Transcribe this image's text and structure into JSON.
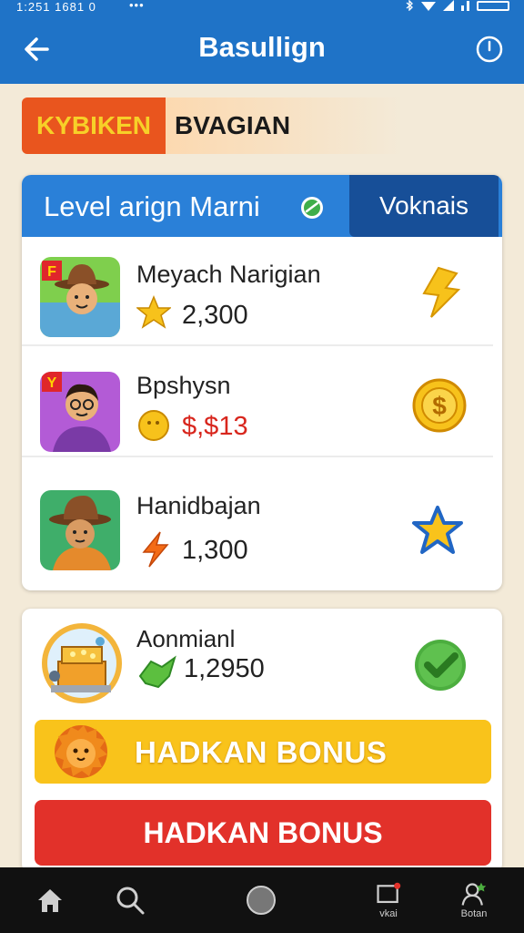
{
  "status_bar": {
    "time": "1:251 1681 0",
    "dots": "•••"
  },
  "app_bar": {
    "title": "Basullign"
  },
  "banner": {
    "left_text": "KYBIKEN",
    "right_text": "BVAGIAN"
  },
  "leaderboard": {
    "header": "Level arign  Marni",
    "tab_label": "Voknais",
    "rows": [
      {
        "name": "Meyach Narigian",
        "score": "2,300",
        "score_color": "#222222",
        "score_icon": "star-icon",
        "reward_icon": "lightning-icon"
      },
      {
        "name": "Bpshysn",
        "score": "$,$13",
        "score_color": "#d8261d",
        "score_icon": "coin-icon",
        "reward_icon": "dollar-coin-icon"
      },
      {
        "name": "Hanidbajan",
        "score": "1,300",
        "score_color": "#222222",
        "score_icon": "lightning-icon",
        "reward_icon": "star-icon"
      }
    ]
  },
  "bonus_panel": {
    "name": "Aonmianl",
    "score": "1,2950",
    "bonus_primary": "HADKAN BONUS",
    "bonus_secondary": "HADKAN BONUS"
  },
  "bottom_nav": {
    "items": [
      {
        "label": "",
        "icon": "home-icon"
      },
      {
        "label": "",
        "icon": "search-icon"
      },
      {
        "label": "",
        "icon": "circle-icon"
      },
      {
        "label": "vkai",
        "icon": "inbox-icon"
      },
      {
        "label": "Botan",
        "icon": "profile-icon"
      }
    ]
  },
  "colors": {
    "accent": "#1f73c7",
    "header_blue": "#2a80d8",
    "dark_tab": "#174f98",
    "yellow": "#f9c31b",
    "red": "#e2312a"
  }
}
